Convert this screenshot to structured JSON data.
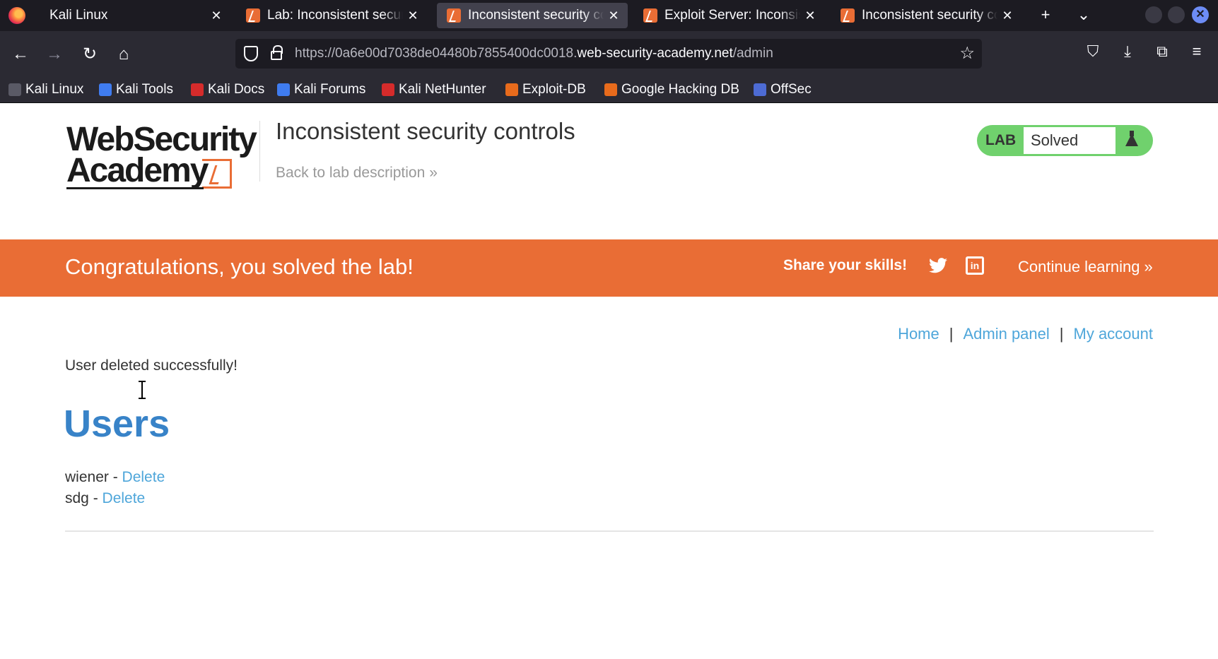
{
  "browser": {
    "tabs": [
      {
        "title": "Kali Linux",
        "active": false
      },
      {
        "title": "Lab: Inconsistent security controls",
        "active": false
      },
      {
        "title": "Inconsistent security controls",
        "active": true
      },
      {
        "title": "Exploit Server: Inconsistent security controls",
        "active": false
      },
      {
        "title": "Inconsistent security controls",
        "active": false
      }
    ],
    "url_prefix": "https://0a6e00d7038de04480b7855400dc0018.",
    "url_domain": "web-security-academy.net",
    "url_path": "/admin",
    "bookmarks": [
      {
        "label": "Kali Linux",
        "color": "#5a5a66"
      },
      {
        "label": "Kali Tools",
        "color": "#3f7cf0"
      },
      {
        "label": "Kali Docs",
        "color": "#d52b2b"
      },
      {
        "label": "Kali Forums",
        "color": "#3f7cf0"
      },
      {
        "label": "Kali NetHunter",
        "color": "#d52b2b"
      },
      {
        "label": "Exploit-DB",
        "color": "#e86b1c"
      },
      {
        "label": "Google Hacking DB",
        "color": "#e86b1c"
      },
      {
        "label": "OffSec",
        "color": "#4d6bd4"
      }
    ]
  },
  "page": {
    "logo_line1": "WebSecurity",
    "logo_line2": "Academy",
    "lab_title": "Inconsistent security controls",
    "back_link": "Back to lab description",
    "lab_tag": "LAB",
    "lab_state": "Solved",
    "banner_message": "Congratulations, you solved the lab!",
    "share_label": "Share your skills!",
    "continue_label": "Continue learning",
    "nav": {
      "home": "Home",
      "admin": "Admin panel",
      "account": "My account",
      "sep": "|"
    },
    "status_message": "User deleted successfully!",
    "users_heading": "Users",
    "users": [
      {
        "name": "wiener",
        "sep": " - ",
        "action": "Delete"
      },
      {
        "name": "sdg",
        "sep": " - ",
        "action": "Delete"
      }
    ]
  },
  "colors": {
    "accent": "#e96d35",
    "link": "#4ea6da",
    "heading": "#3883c8",
    "solved": "#70d16d"
  }
}
